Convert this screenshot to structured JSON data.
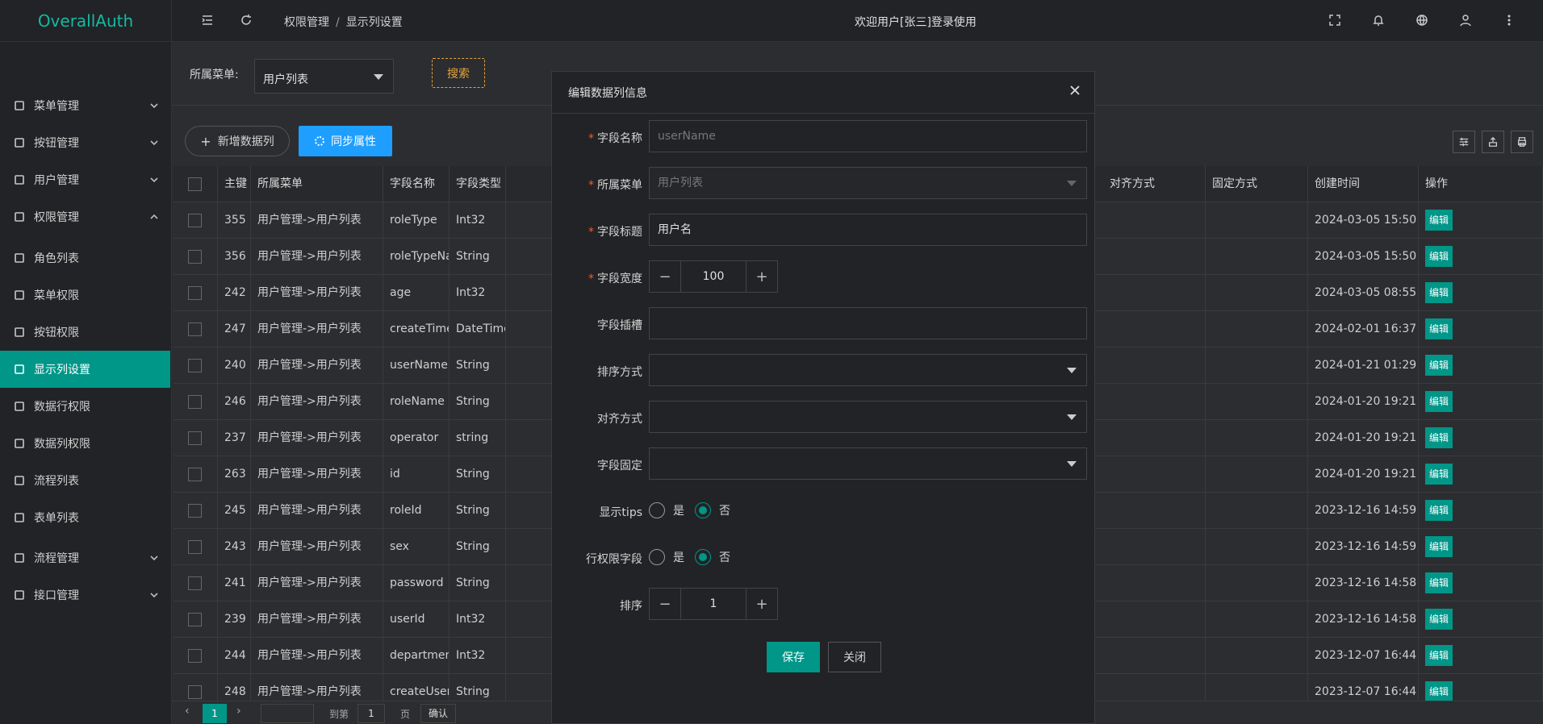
{
  "app": {
    "title": "OverallAuth"
  },
  "sidebar": {
    "items": [
      {
        "label": "菜单管理",
        "icon": "menu-manage-icon"
      },
      {
        "label": "按钮管理",
        "icon": "button-manage-icon"
      },
      {
        "label": "用户管理",
        "icon": "user-icon"
      },
      {
        "label": "权限管理",
        "icon": "shield-icon"
      },
      {
        "label": "角色列表",
        "icon": "calendar-icon"
      },
      {
        "label": "菜单权限",
        "icon": "list-icon"
      },
      {
        "label": "按钮权限",
        "icon": "cube-icon"
      },
      {
        "label": "显示列设置",
        "icon": "grid-icon"
      },
      {
        "label": "数据行权限",
        "icon": "sliders-icon"
      },
      {
        "label": "数据列权限",
        "icon": "columns-icon"
      },
      {
        "label": "流程列表",
        "icon": "share-icon"
      },
      {
        "label": "表单列表",
        "icon": "clipboard-icon"
      },
      {
        "label": "流程管理",
        "icon": "share-icon"
      },
      {
        "label": "接口管理",
        "icon": "user-link-icon"
      }
    ]
  },
  "header": {
    "breadcrumb": [
      "权限管理",
      "显示列设置"
    ],
    "welcome": "欢迎用户[张三]登录使用"
  },
  "filter": {
    "label": "所属菜单:",
    "value": "用户列表",
    "search": "搜索"
  },
  "toolbar": {
    "add": "新增数据列",
    "sync": "同步属性"
  },
  "table": {
    "headers": [
      "主键",
      "所属菜单",
      "字段名称",
      "字段类型",
      "对齐方式",
      "固定方式",
      "创建时间",
      "操作"
    ],
    "edit_label": "编辑",
    "rows": [
      {
        "id": "355",
        "menu": "用户管理->用户列表",
        "field": "roleType",
        "type": "Int32",
        "created": "2024-03-05 15:50"
      },
      {
        "id": "356",
        "menu": "用户管理->用户列表",
        "field": "roleTypeName",
        "type": "String",
        "created": "2024-03-05 15:50"
      },
      {
        "id": "242",
        "menu": "用户管理->用户列表",
        "field": "age",
        "type": "Int32",
        "created": "2024-03-05 08:55"
      },
      {
        "id": "247",
        "menu": "用户管理->用户列表",
        "field": "createTime",
        "type": "DateTime",
        "created": "2024-02-01 16:37"
      },
      {
        "id": "240",
        "menu": "用户管理->用户列表",
        "field": "userName",
        "type": "String",
        "created": "2024-01-21 01:29"
      },
      {
        "id": "246",
        "menu": "用户管理->用户列表",
        "field": "roleName",
        "type": "String",
        "created": "2024-01-20 19:21"
      },
      {
        "id": "237",
        "menu": "用户管理->用户列表",
        "field": "operator",
        "type": "string",
        "created": "2024-01-20 19:21"
      },
      {
        "id": "263",
        "menu": "用户管理->用户列表",
        "field": "id",
        "type": "String",
        "created": "2024-01-20 19:21"
      },
      {
        "id": "245",
        "menu": "用户管理->用户列表",
        "field": "roleId",
        "type": "String",
        "created": "2023-12-16 14:59"
      },
      {
        "id": "243",
        "menu": "用户管理->用户列表",
        "field": "sex",
        "type": "String",
        "created": "2023-12-16 14:59"
      },
      {
        "id": "241",
        "menu": "用户管理->用户列表",
        "field": "password",
        "type": "String",
        "created": "2023-12-16 14:58"
      },
      {
        "id": "239",
        "menu": "用户管理->用户列表",
        "field": "userId",
        "type": "Int32",
        "created": "2023-12-16 14:58"
      },
      {
        "id": "244",
        "menu": "用户管理->用户列表",
        "field": "departmentId",
        "type": "Int32",
        "created": "2023-12-07 16:44"
      },
      {
        "id": "248",
        "menu": "用户管理->用户列表",
        "field": "createUser",
        "type": "String",
        "created": "2023-12-07 16:44"
      }
    ]
  },
  "pager": {
    "current": "1",
    "goto_label": "到第",
    "goto_value": "1",
    "page_label": "页",
    "confirm": "确认"
  },
  "modal": {
    "title": "编辑数据列信息",
    "field_name": {
      "label": "字段名称",
      "placeholder": "userName"
    },
    "menu": {
      "label": "所属菜单",
      "value": "用户列表"
    },
    "field_title": {
      "label": "字段标题",
      "value": "用户名"
    },
    "width": {
      "label": "字段宽度",
      "value": "100"
    },
    "slot": {
      "label": "字段插槽",
      "value": ""
    },
    "sort": {
      "label": "排序方式"
    },
    "align": {
      "label": "对齐方式"
    },
    "fixed": {
      "label": "字段固定"
    },
    "tips": {
      "label": "显示tips",
      "yes": "是",
      "no": "否"
    },
    "row_perm": {
      "label": "行权限字段",
      "yes": "是",
      "no": "否"
    },
    "order": {
      "label": "排序",
      "value": "1"
    },
    "save": "保存",
    "close": "关闭"
  }
}
